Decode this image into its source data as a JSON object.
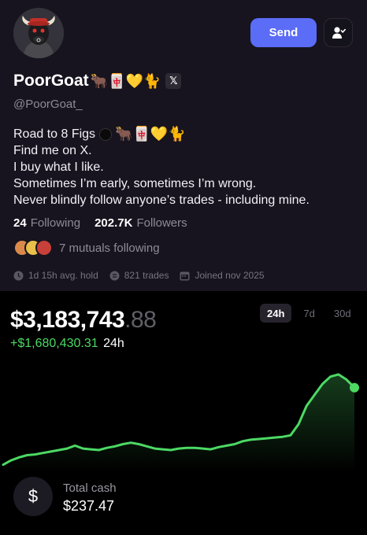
{
  "profile": {
    "name": "PoorGoat",
    "name_emojis": "🐂🀄💛🐈",
    "x_badge": "𝕏",
    "handle": "@PoorGoat_",
    "bio": {
      "line1_text": "Road to 8 Figs",
      "line1_emojis": "🐂🀄💛🐈",
      "line2": "Find me on X.",
      "line3": "I buy what I like.",
      "line4": "Sometimes I’m early, sometimes I’m wrong.",
      "line5": "Never blindly follow anyone’s trades - including mine."
    },
    "following_count": "24",
    "following_label": "Following",
    "followers_count": "202.7K",
    "followers_label": "Followers",
    "mutuals_text": "7 mutuals following",
    "avg_hold": "1d 15h avg. hold",
    "trades": "821 trades",
    "joined": "Joined nov 2025"
  },
  "actions": {
    "send_label": "Send"
  },
  "portfolio": {
    "value_main": "$3,183,743",
    "value_cents": ".88",
    "change_amount": "+$1,680,430.31",
    "change_period": "24h",
    "tabs": [
      "24h",
      "7d",
      "30d"
    ],
    "active_tab": "24h",
    "cash_icon": "$",
    "cash_label": "Total cash",
    "cash_value": "$237.47"
  },
  "colors": {
    "accent": "#5b6cf6",
    "positive": "#4cd964",
    "panel": "#17141f"
  },
  "chart_data": {
    "type": "line",
    "title": "",
    "xlabel": "",
    "ylabel": "",
    "x": [
      0,
      1,
      2,
      3,
      4,
      5,
      6,
      7,
      8,
      9,
      10,
      11,
      12,
      13,
      14,
      15,
      16,
      17,
      18,
      19,
      20,
      21,
      22,
      23,
      24,
      25,
      26,
      27,
      28,
      29,
      30,
      31,
      32,
      33,
      34,
      35,
      36,
      37,
      38,
      39,
      40,
      41,
      42,
      43,
      44
    ],
    "values": [
      1.5,
      1.56,
      1.6,
      1.63,
      1.64,
      1.66,
      1.68,
      1.7,
      1.72,
      1.76,
      1.72,
      1.71,
      1.7,
      1.73,
      1.75,
      1.78,
      1.8,
      1.78,
      1.75,
      1.72,
      1.71,
      1.7,
      1.72,
      1.73,
      1.73,
      1.72,
      1.71,
      1.74,
      1.76,
      1.78,
      1.82,
      1.84,
      1.85,
      1.86,
      1.87,
      1.88,
      1.9,
      2.05,
      2.3,
      2.45,
      2.6,
      2.7,
      2.73,
      2.66,
      2.55
    ],
    "ylim": [
      1.4,
      2.9
    ],
    "grid": false,
    "color": "#4cd964"
  }
}
